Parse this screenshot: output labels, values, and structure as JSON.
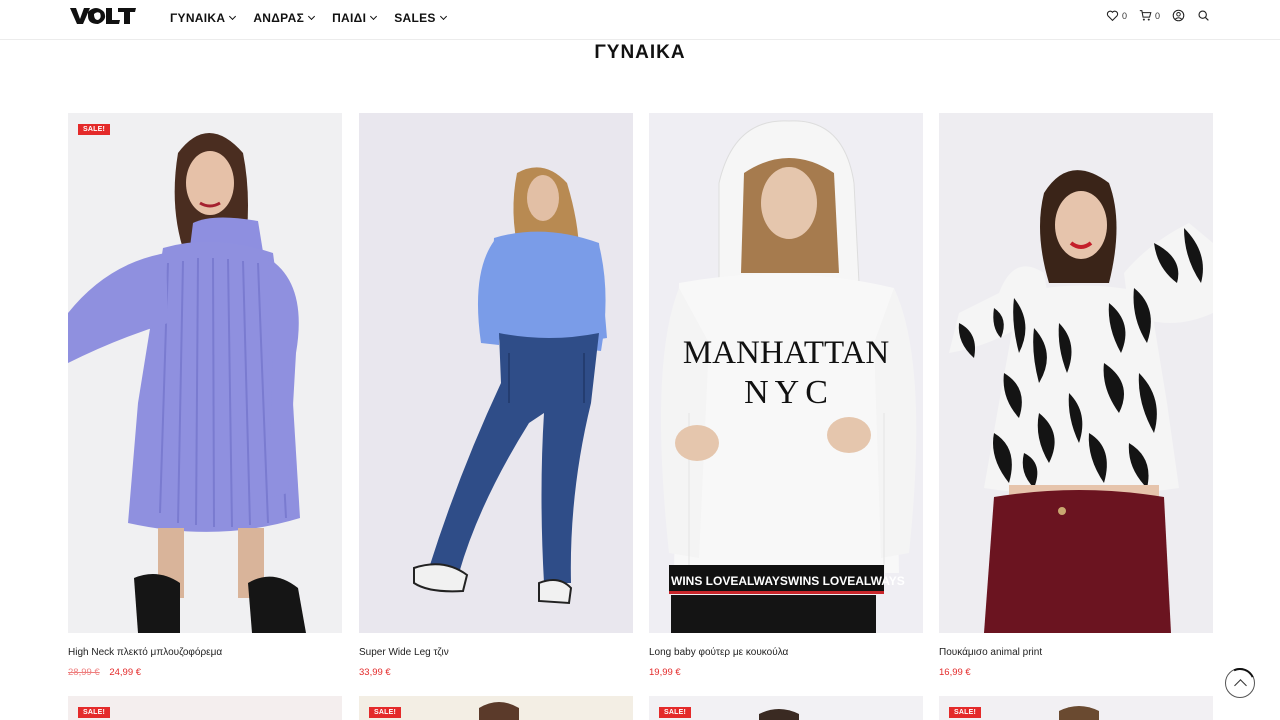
{
  "header": {
    "logo_text": "VOLT",
    "nav": [
      {
        "label": "ΓΥΝΑΙΚΑ"
      },
      {
        "label": "ΑΝΔΡΑΣ"
      },
      {
        "label": "ΠΑΙΔΙ"
      },
      {
        "label": "SALES"
      }
    ],
    "wishlist_count": "0",
    "cart_count": "0",
    "icons": [
      "heart-icon",
      "cart-icon",
      "account-icon",
      "search-icon"
    ]
  },
  "page_title": "ΓΥΝΑΙΚΑ",
  "products": [
    {
      "name": "High Neck πλεκτό μπλουζοφόρεμα",
      "old_price": "28,99 €",
      "price": "24,99 €",
      "sale": "SALE!"
    },
    {
      "name": "Super Wide Leg τζιν",
      "old_price": "",
      "price": "33,99 €",
      "sale": ""
    },
    {
      "name": "Long baby φούτερ με κουκούλα",
      "old_price": "",
      "price": "19,99 €",
      "sale": ""
    },
    {
      "name": "Πουκάμισο animal print",
      "old_price": "",
      "price": "16,99 €",
      "sale": ""
    }
  ],
  "hoodie_print": {
    "line1": "MANHATTAN",
    "line2": "NYC",
    "band": "WINS LOVEALWAYSWINS LOVEALWAYS"
  },
  "next_row_badge": "SALE!",
  "colors": {
    "accent": "#e42a2a",
    "text": "#111111"
  }
}
